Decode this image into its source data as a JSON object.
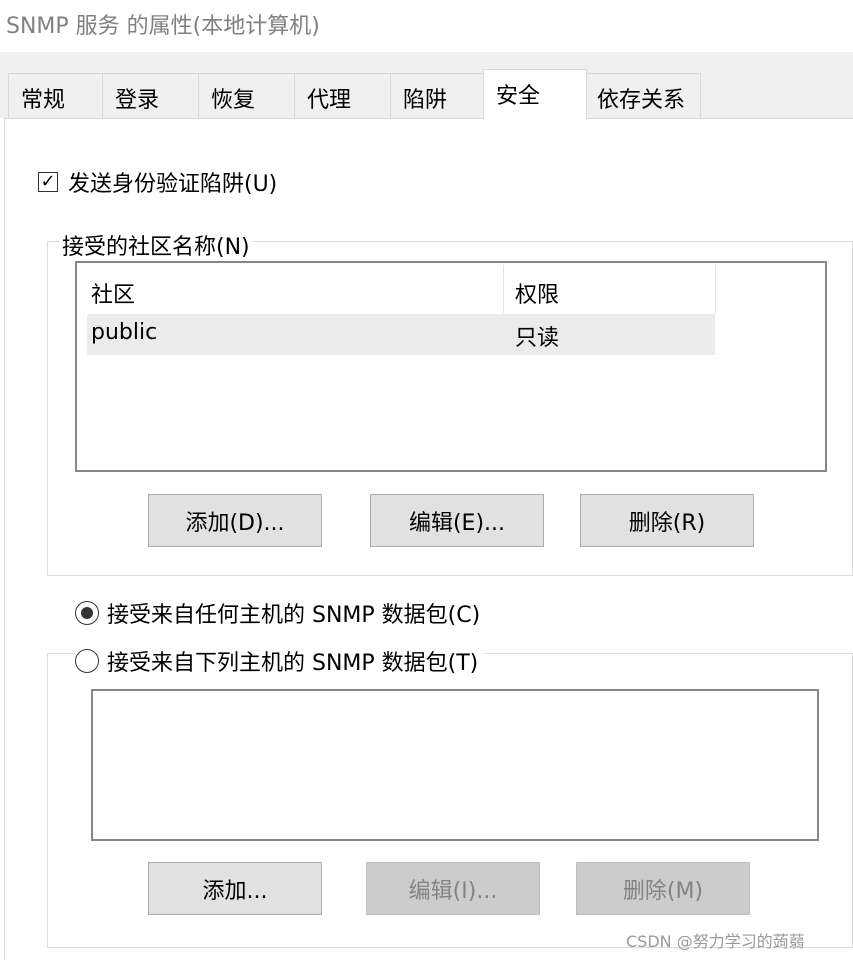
{
  "window": {
    "title": "SNMP 服务 的属性(本地计算机)"
  },
  "tabs": [
    {
      "label": "常规"
    },
    {
      "label": "登录"
    },
    {
      "label": "恢复"
    },
    {
      "label": "代理"
    },
    {
      "label": "陷阱"
    },
    {
      "label": "安全",
      "active": true
    },
    {
      "label": "依存关系"
    }
  ],
  "security": {
    "send_auth_trap": {
      "label": "发送身份验证陷阱(U)",
      "checked": true,
      "check_glyph": "✓"
    },
    "communities": {
      "group_label": "接受的社区名称(N)",
      "columns": [
        "社区",
        "权限"
      ],
      "rows": [
        {
          "community": "public",
          "rights": "只读"
        }
      ],
      "buttons": {
        "add": "添加(D)...",
        "edit": "编辑(E)...",
        "remove": "删除(R)"
      }
    },
    "accept_any": {
      "label": "接受来自任何主机的 SNMP 数据包(C)",
      "selected": true
    },
    "accept_listed": {
      "label": "接受来自下列主机的 SNMP 数据包(T)",
      "selected": false,
      "buttons": {
        "add": "添加...",
        "edit": "编辑(I)...",
        "remove": "删除(M)"
      }
    }
  },
  "watermark": "CSDN @努力学习的蒟蒻",
  "colors": {
    "tab_bg": "#f0f0f0",
    "button_bg": "#e1e1e1",
    "button_disabled_bg": "#cccccc",
    "disabled_text": "#838383",
    "selected_row_bg": "#ebebeb",
    "title_text": "#808080"
  }
}
